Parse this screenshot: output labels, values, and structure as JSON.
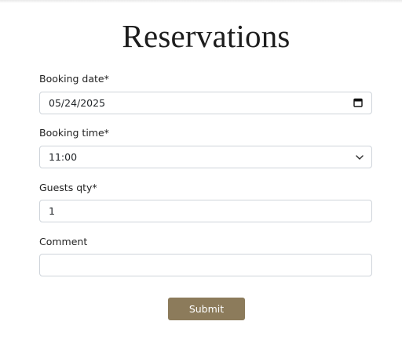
{
  "page": {
    "title": "Reservations"
  },
  "form": {
    "booking_date": {
      "label": "Booking date*",
      "value": "05/24/2025",
      "icon": "calendar-icon"
    },
    "booking_time": {
      "label": "Booking time*",
      "value": "11:00",
      "icon": "chevron-down-icon"
    },
    "guests_qty": {
      "label": "Guests qty*",
      "value": "1"
    },
    "comment": {
      "label": "Comment",
      "value": ""
    },
    "submit_label": "Submit"
  },
  "colors": {
    "submit_bg": "#8c7b5b",
    "input_border": "#ced4da"
  }
}
